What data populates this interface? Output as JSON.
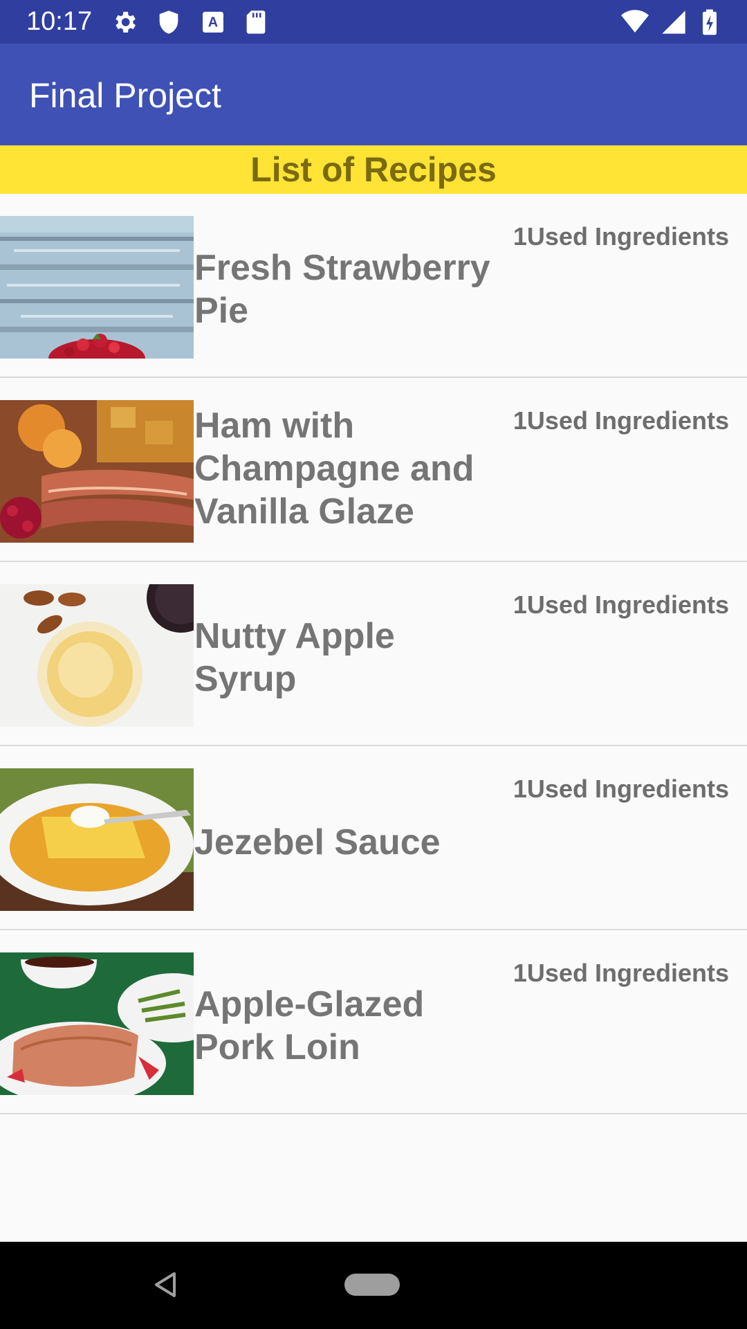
{
  "status_bar": {
    "time": "10:17",
    "icons": [
      "gear-icon",
      "shield-icon",
      "font-icon",
      "sd-card-icon",
      "wifi-icon",
      "signal-icon",
      "battery-icon"
    ]
  },
  "app_bar": {
    "title": "Final Project"
  },
  "banner": {
    "text": "List of Recipes"
  },
  "recipes": [
    {
      "title": "Fresh Strawberry Pie",
      "meta": "1Used Ingredients"
    },
    {
      "title": "Ham with Champagne and Vanilla Glaze",
      "meta": "1Used Ingredients"
    },
    {
      "title": "Nutty Apple Syrup",
      "meta": "1Used Ingredients"
    },
    {
      "title": "Jezebel Sauce",
      "meta": "1Used Ingredients"
    },
    {
      "title": "Apple-Glazed Pork Loin",
      "meta": "1Used Ingredients"
    }
  ],
  "nav_bar": {
    "icons": [
      "back-icon",
      "home-icon"
    ]
  },
  "colors": {
    "status_bar": "#303f9f",
    "app_bar": "#3f51b5",
    "banner": "#ffe335",
    "banner_text": "#7a6a10",
    "title_text": "#757575"
  }
}
